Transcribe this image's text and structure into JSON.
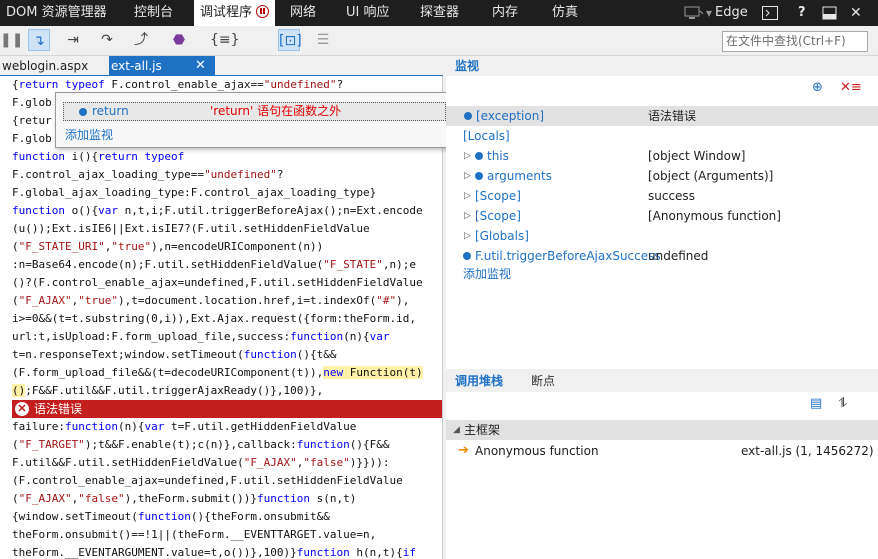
{
  "topbar": {
    "title": "DOM 资源管理器",
    "tabs": [
      "控制台",
      "调试程序",
      "网络",
      "UI 响应",
      "探查器",
      "内存",
      "仿真"
    ],
    "engine": "Edge"
  },
  "toolbar": {
    "search_placeholder": "在文件中查找(Ctrl+F)"
  },
  "files": {
    "tabs": [
      "weblogin.aspx",
      "ext-all.js"
    ]
  },
  "popup": {
    "item_name": "return",
    "item_value": "'return' 语句在函数之外",
    "add_label": "添加监视"
  },
  "code": {
    "error_label": "语法错误"
  },
  "watch": {
    "title": "监视",
    "rows": [
      {
        "name": "[exception]",
        "value": "语法错误"
      },
      {
        "name": "[Locals]",
        "value": ""
      },
      {
        "name": "this",
        "value": "[object Window]"
      },
      {
        "name": "arguments",
        "value": "[object (Arguments)]"
      },
      {
        "name": "[Scope]",
        "value": "success"
      },
      {
        "name": "[Scope]",
        "value": "[Anonymous function]"
      },
      {
        "name": "[Globals]",
        "value": ""
      },
      {
        "name": "F.util.triggerBeforeAjaxSuccess",
        "value": "undefined"
      }
    ],
    "add_label": "添加监视"
  },
  "callstack": {
    "tabs": [
      "调用堆栈",
      "断点"
    ],
    "group": "主框架",
    "frames": [
      {
        "name": "Anonymous function",
        "location": "ext-all.js (1, 1456272)"
      }
    ]
  },
  "colors": {
    "accent": "#1f71c4",
    "error": "#c41e1e",
    "topbar": "#1e1e1e"
  }
}
